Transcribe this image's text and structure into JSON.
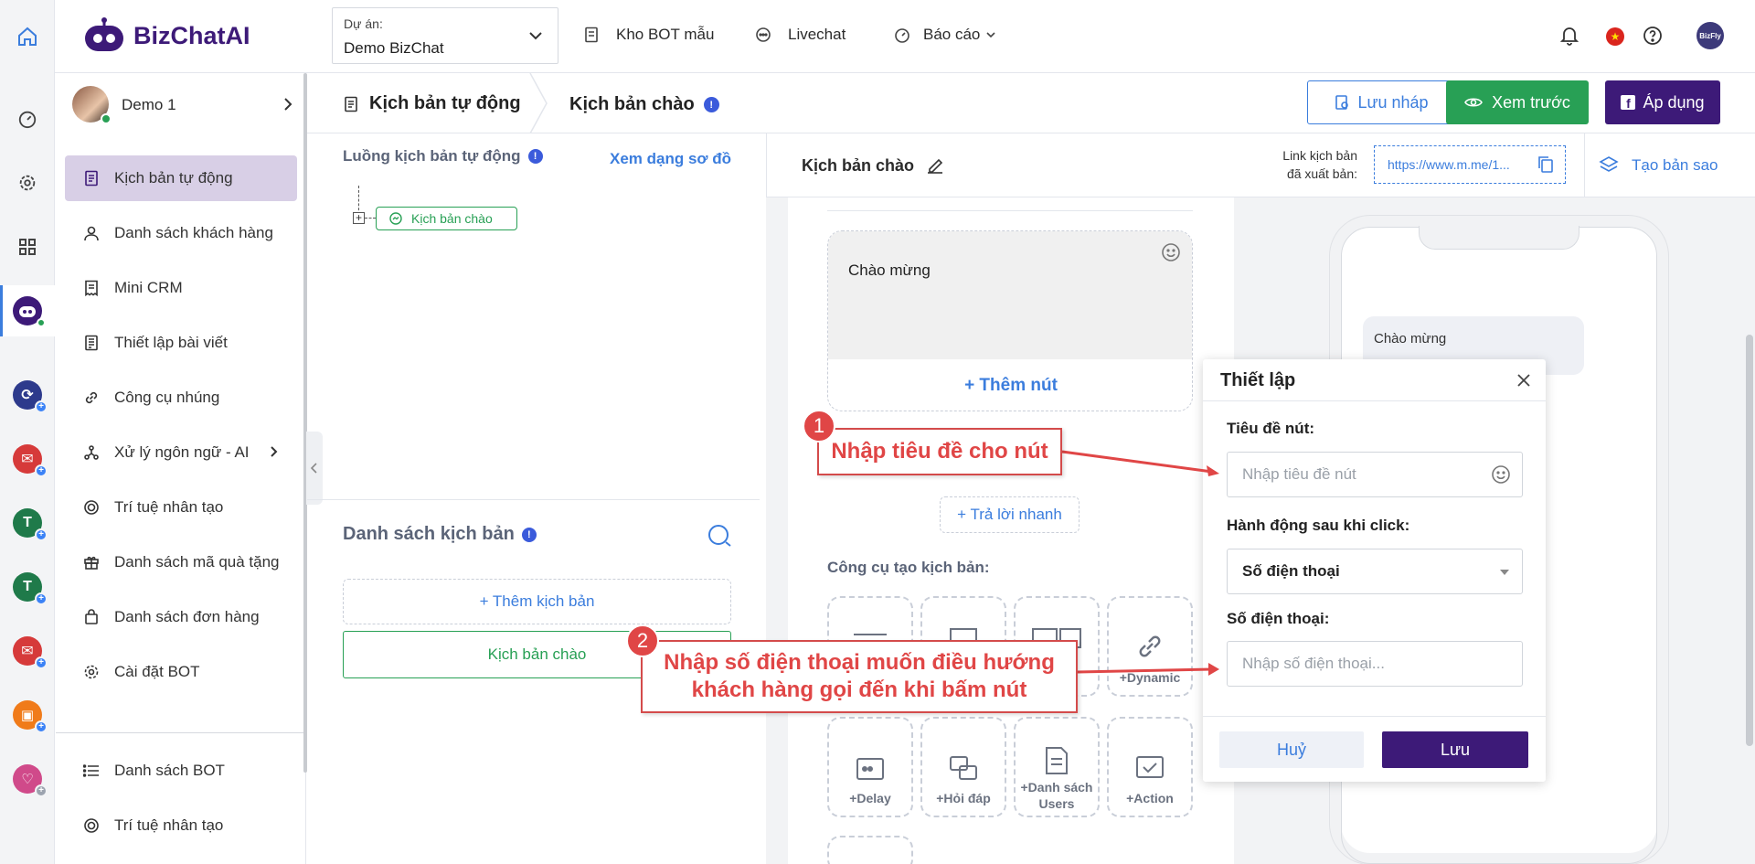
{
  "app": {
    "brand": "BizChatAI"
  },
  "topbar": {
    "project_label": "Dự án:",
    "project_value": "Demo BizChat",
    "nav": [
      {
        "label": "Kho BOT mẫu",
        "icon": "template-icon"
      },
      {
        "label": "Livechat",
        "icon": "chat-icon"
      },
      {
        "label": "Báo cáo",
        "icon": "gauge-icon"
      }
    ],
    "avatar_text": "BizFly"
  },
  "user": {
    "name": "Demo 1"
  },
  "menu": {
    "items": [
      {
        "label": "Kịch bản tự động"
      },
      {
        "label": "Danh sách khách hàng"
      },
      {
        "label": "Mini CRM"
      },
      {
        "label": "Thiết lập bài viết"
      },
      {
        "label": "Công cụ nhúng"
      },
      {
        "label": "Xử lý ngôn ngữ - AI"
      },
      {
        "label": "Trí tuệ nhân tạo"
      },
      {
        "label": "Danh sách mã quà tặng"
      },
      {
        "label": "Danh sách đơn hàng"
      },
      {
        "label": "Cài đặt BOT"
      }
    ],
    "bottom": [
      {
        "label": "Danh sách BOT"
      },
      {
        "label": "Trí tuệ nhân tạo"
      }
    ]
  },
  "breadcrumb": {
    "first": "Kịch bản tự động",
    "second": "Kịch bản chào"
  },
  "actions": {
    "draft": "Lưu nháp",
    "preview": "Xem trước",
    "apply": "Áp dụng"
  },
  "flow": {
    "title": "Luồng kịch bản tự động",
    "view_diagram": "Xem dạng sơ đồ",
    "node": "Kịch bản chào"
  },
  "scripts": {
    "title": "Danh sách kịch bản",
    "add": "+ Thêm kịch bản",
    "items": [
      "Kịch bản chào"
    ]
  },
  "editor": {
    "title": "Kịch bản chào",
    "link_label_1": "Link kịch bản",
    "link_label_2": "đã xuất bản:",
    "link_value": "https://www.m.me/1...",
    "duplicate": "Tạo bản sao",
    "message": "Chào mừng",
    "add_button": "+ Thêm nút",
    "quick_reply": "+ Trả lời nhanh",
    "tools_title": "Công cụ tạo kịch bản:",
    "tools": [
      "+Dynamic",
      "+Delay",
      "+Hỏi đáp",
      "+Danh sách Users",
      "+Action"
    ]
  },
  "phone": {
    "bubble": "Chào mừng"
  },
  "modal": {
    "title": "Thiết lập",
    "button_title_label": "Tiêu đề nút:",
    "button_title_placeholder": "Nhập tiêu đề nút",
    "action_label": "Hành động sau khi click:",
    "action_value": "Số điện thoại",
    "phone_label": "Số điện thoại:",
    "phone_placeholder": "Nhập số điện thoại...",
    "cancel": "Huỷ",
    "save": "Lưu"
  },
  "annotations": [
    {
      "number": "1",
      "text": "Nhập tiêu đề cho nút"
    },
    {
      "number": "2",
      "line1": "Nhập số điện thoại muốn điều hướng",
      "line2": "khách hàng gọi đến khi bấm nút"
    }
  ],
  "colors": {
    "brand": "#3d1a78",
    "green": "#28a055",
    "accent": "#3b7ddd",
    "annotation": "#e04646"
  }
}
